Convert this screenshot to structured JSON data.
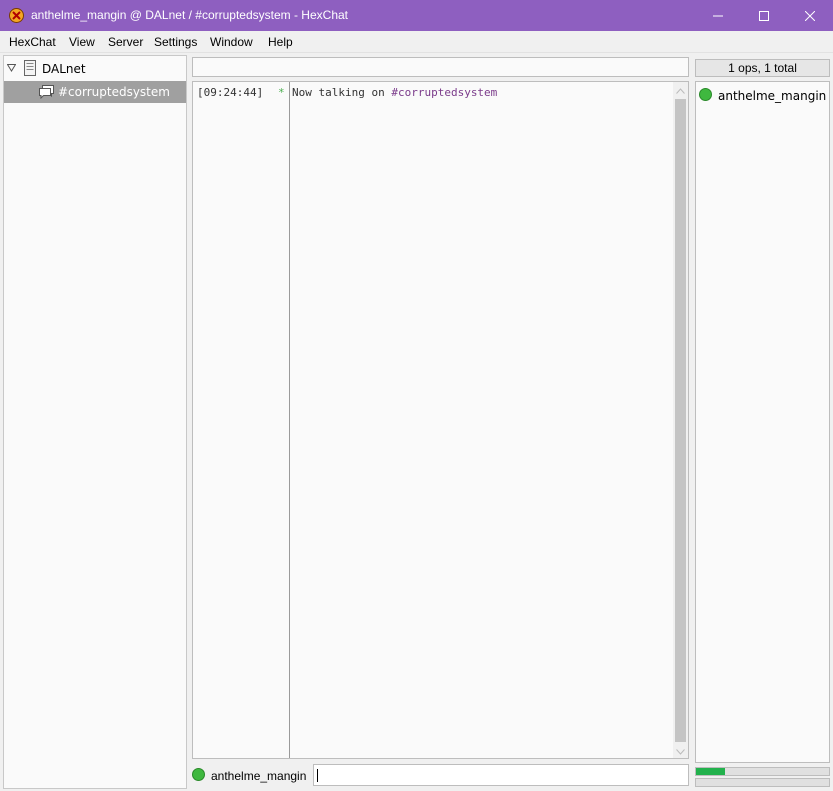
{
  "window": {
    "title": "anthelme_mangin @ DALnet / #corruptedsystem - HexChat"
  },
  "menu": [
    "HexChat",
    "View",
    "Server",
    "Settings",
    "Window",
    "Help"
  ],
  "tree": {
    "server": "DALnet",
    "channel": "#corruptedsystem"
  },
  "topic": "",
  "chat": {
    "timestamp": "[09:24:44]",
    "marker": "*",
    "message_prefix": "Now talking on ",
    "message_channel": "#corruptedsystem"
  },
  "userlist": {
    "count": "1 ops, 1 total",
    "users": [
      "anthelme_mangin"
    ]
  },
  "input": {
    "nick": "anthelme_mangin",
    "value": ""
  },
  "lag_meter": {
    "fraction": 0.22
  },
  "colors": {
    "titlebar": "#8e5fc0",
    "op_dot": "#3fb83f",
    "channel_text": "#7a3a8a",
    "selected_row": "#a0a0a0"
  }
}
